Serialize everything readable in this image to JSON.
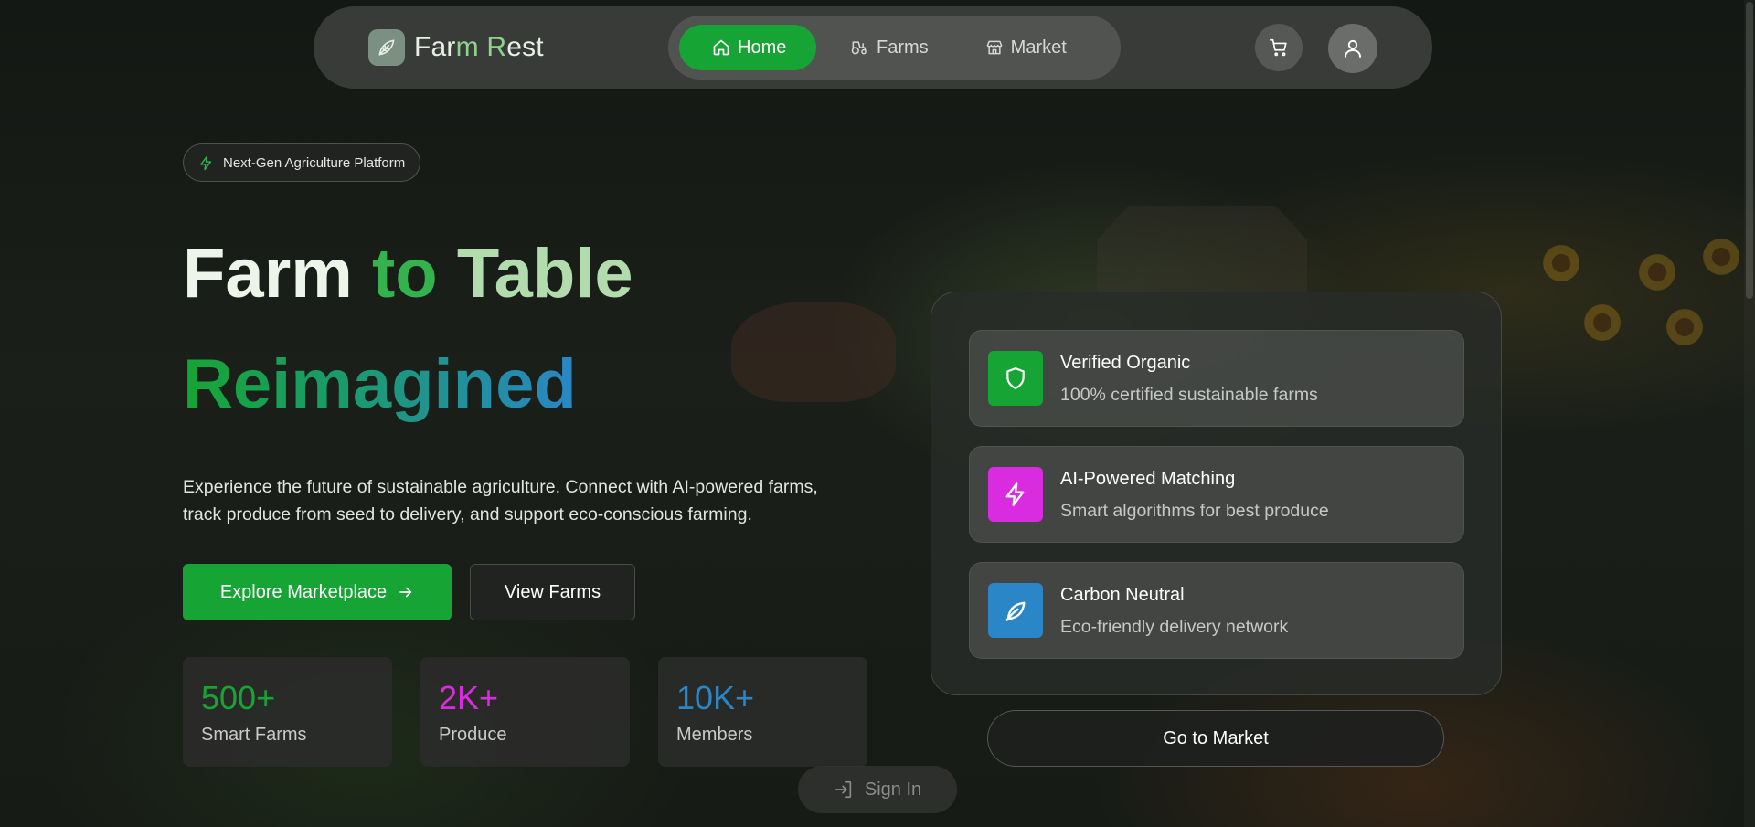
{
  "brand": {
    "name_part1": "Far",
    "name_part2": "m R",
    "name_part3": "est",
    "logo_icon": "leaf-logo-icon"
  },
  "nav": {
    "items": [
      {
        "label": "Home",
        "icon": "home-icon",
        "active": true
      },
      {
        "label": "Farms",
        "icon": "tractor-icon",
        "active": false
      },
      {
        "label": "Market",
        "icon": "store-icon",
        "active": false
      }
    ],
    "cart_icon": "cart-icon",
    "user_icon": "user-icon"
  },
  "hero": {
    "badge": "Next-Gen Agriculture Platform",
    "title_word1": "Farm",
    "title_word2": "to",
    "title_word3": "Table",
    "title_line2": "Reimagined",
    "description": "Experience the future of sustainable agriculture. Connect with AI-powered farms, track produce from seed to delivery, and support eco-conscious farming.",
    "primary_button": "Explore Marketplace",
    "secondary_button": "View Farms"
  },
  "stats": [
    {
      "value": "500+",
      "label": "Smart Farms",
      "color": "#16a534"
    },
    {
      "value": "2K+",
      "label": "Produce",
      "color": "#d92ce0"
    },
    {
      "value": "10K+",
      "label": "Members",
      "color": "#2a86c6"
    }
  ],
  "features": [
    {
      "title": "Verified Organic",
      "subtitle": "100% certified sustainable farms",
      "icon": "shield-icon",
      "color": "#16a534"
    },
    {
      "title": "AI-Powered Matching",
      "subtitle": "Smart algorithms for best produce",
      "icon": "lightning-icon",
      "color": "#d92ce0"
    },
    {
      "title": "Carbon Neutral",
      "subtitle": "Eco-friendly delivery network",
      "icon": "leaf-icon",
      "color": "#2a86c6"
    }
  ],
  "go_market_button": "Go to Market",
  "signin_button": "Sign In",
  "colors": {
    "accent": "#16a534",
    "purple": "#d92ce0",
    "blue": "#2a86c6"
  }
}
